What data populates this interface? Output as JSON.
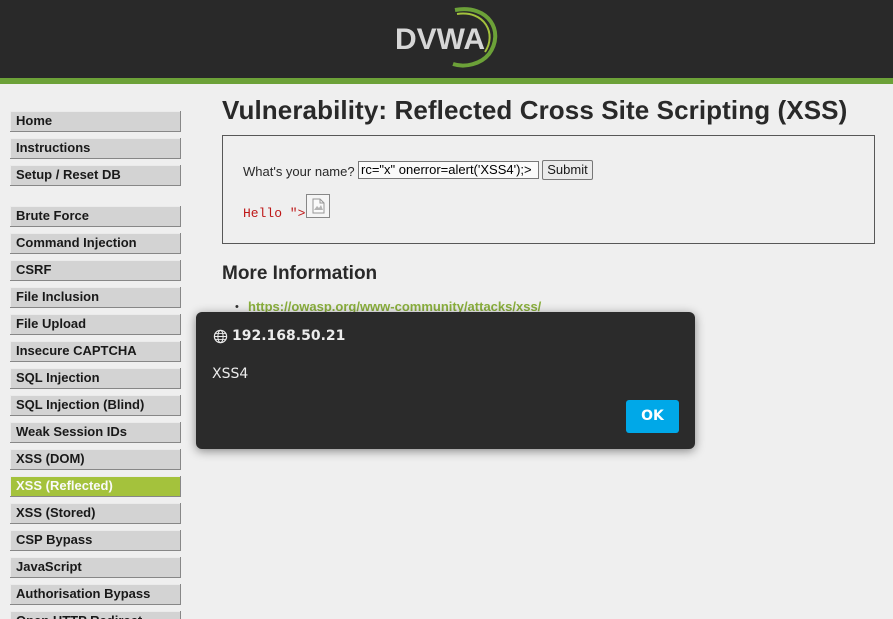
{
  "header": {
    "logo_text": "DVWA",
    "accent_color": "#6fa53a",
    "background_color": "#2a2a2a"
  },
  "menu": {
    "group1": [
      {
        "label": "Home"
      },
      {
        "label": "Instructions"
      },
      {
        "label": "Setup / Reset DB"
      }
    ],
    "group2": [
      {
        "label": "Brute Force"
      },
      {
        "label": "Command Injection"
      },
      {
        "label": "CSRF"
      },
      {
        "label": "File Inclusion"
      },
      {
        "label": "File Upload"
      },
      {
        "label": "Insecure CAPTCHA"
      },
      {
        "label": "SQL Injection"
      },
      {
        "label": "SQL Injection (Blind)"
      },
      {
        "label": "Weak Session IDs"
      },
      {
        "label": "XSS (DOM)"
      },
      {
        "label": "XSS (Reflected)",
        "active": true
      },
      {
        "label": "XSS (Stored)"
      },
      {
        "label": "CSP Bypass"
      },
      {
        "label": "JavaScript"
      },
      {
        "label": "Authorisation Bypass"
      },
      {
        "label": "Open HTTP Redirect"
      }
    ],
    "active_color": "#a8c63e"
  },
  "main": {
    "title": "Vulnerability: Reflected Cross Site Scripting (XSS)",
    "form": {
      "label": "What's your name?",
      "input_value": "rc=\"x\" onerror=alert('XSS4');>",
      "submit_label": "Submit"
    },
    "output": {
      "hello_text": "Hello \">",
      "image_icon": "broken-image-icon"
    },
    "more_info": {
      "heading": "More Information",
      "links": [
        {
          "text": "https://owasp.org/www-community/attacks/xss/"
        }
      ]
    }
  },
  "dialog": {
    "origin": "192.168.50.21",
    "origin_icon": "globe-icon",
    "message": "XSS4",
    "ok_label": "OK",
    "ok_color": "#00a8e8"
  }
}
